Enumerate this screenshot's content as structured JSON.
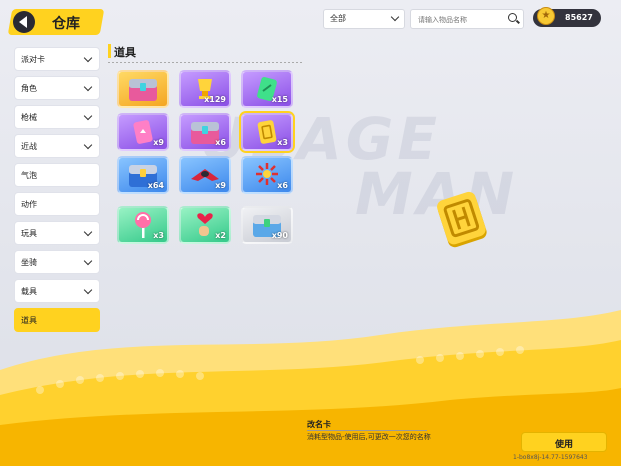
{
  "header": {
    "title": "仓库"
  },
  "filter": {
    "selected": "全部"
  },
  "search": {
    "placeholder": "请输入物品名称"
  },
  "currency": {
    "amount": "85627"
  },
  "sidebar": {
    "items": [
      {
        "label": "派对卡",
        "expandable": true
      },
      {
        "label": "角色",
        "expandable": true
      },
      {
        "label": "枪械",
        "expandable": true
      },
      {
        "label": "近战",
        "expandable": true
      },
      {
        "label": "气泡",
        "expandable": false
      },
      {
        "label": "动作",
        "expandable": false
      },
      {
        "label": "玩具",
        "expandable": true
      },
      {
        "label": "坐骑",
        "expandable": true
      },
      {
        "label": "载具",
        "expandable": true
      },
      {
        "label": "道具",
        "expandable": false,
        "active": true
      }
    ]
  },
  "section": {
    "title": "道具"
  },
  "items": [
    {
      "icon": "chest-icon",
      "rarity": "gold",
      "count": ""
    },
    {
      "icon": "trophy-icon",
      "rarity": "purple",
      "count": "x129"
    },
    {
      "icon": "card-icon",
      "rarity": "purple",
      "count": "x15"
    },
    {
      "icon": "ticket-icon",
      "rarity": "purple",
      "count": "x9"
    },
    {
      "icon": "chest-icon",
      "rarity": "purple",
      "count": "x6"
    },
    {
      "icon": "rename-card-icon",
      "rarity": "purple",
      "count": "x3",
      "selected": true
    },
    {
      "icon": "chest-icon",
      "rarity": "blue",
      "count": "x64"
    },
    {
      "icon": "spaceship-icon",
      "rarity": "blue",
      "count": "x9"
    },
    {
      "icon": "firework-icon",
      "rarity": "blue",
      "count": "x6"
    },
    {
      "icon": "lollipop-icon",
      "rarity": "green",
      "count": "x3"
    },
    {
      "icon": "heart-glove-icon",
      "rarity": "green",
      "count": "x2"
    },
    {
      "icon": "chest-icon",
      "rarity": "grey",
      "count": "x90"
    }
  ],
  "details": {
    "name": "改名卡",
    "description": "消耗型物品-使用后,可更改一次您的名称",
    "use_label": "使用",
    "uid": "1-bo8x8j-14.77-1597643"
  },
  "background_text": [
    "USAGE",
    "MAN"
  ],
  "colors": {
    "accent": "#ffd21f",
    "dark": "#2a2a33"
  }
}
